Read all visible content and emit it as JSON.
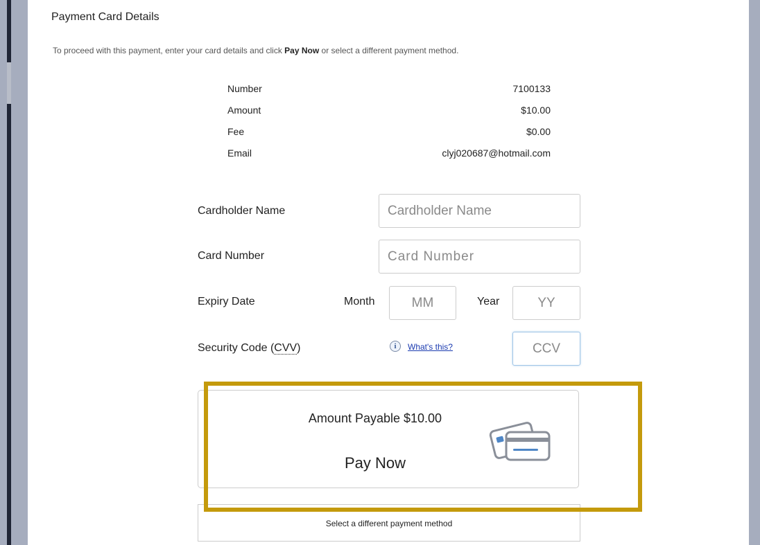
{
  "page": {
    "title": "Payment Card Details",
    "intro_before": "To proceed with this payment, enter your card details and click ",
    "intro_bold": "Pay Now",
    "intro_after": " or select a different payment method."
  },
  "summary": [
    {
      "label": "Number",
      "value": "7100133"
    },
    {
      "label": "Amount",
      "value": "$10.00"
    },
    {
      "label": "Fee",
      "value": "$0.00"
    },
    {
      "label": "Email",
      "value": "clyj020687@hotmail.com"
    }
  ],
  "form": {
    "cardholder_label": "Cardholder Name",
    "cardholder_placeholder": "Cardholder Name",
    "cardnumber_label": "Card Number",
    "cardnumber_placeholder": "Card Number",
    "expiry_label": "Expiry Date",
    "month_label": "Month",
    "month_placeholder": "MM",
    "year_label": "Year",
    "year_placeholder": "YY",
    "cvv_label_prefix": "Security Code (",
    "cvv_abbr": "CVV",
    "cvv_label_suffix": ")",
    "info_glyph": "i",
    "whats_this": "What's this?",
    "cvv_placeholder": "CCV"
  },
  "pay": {
    "amount_payable": "Amount Payable $10.00",
    "button_label": "Pay Now",
    "icon": "credit-cards-icon"
  },
  "alternate": {
    "label": "Select a different payment method"
  },
  "colors": {
    "highlight": "#c49a0c",
    "link": "#1a3ab0",
    "background": "#a6adbe"
  }
}
